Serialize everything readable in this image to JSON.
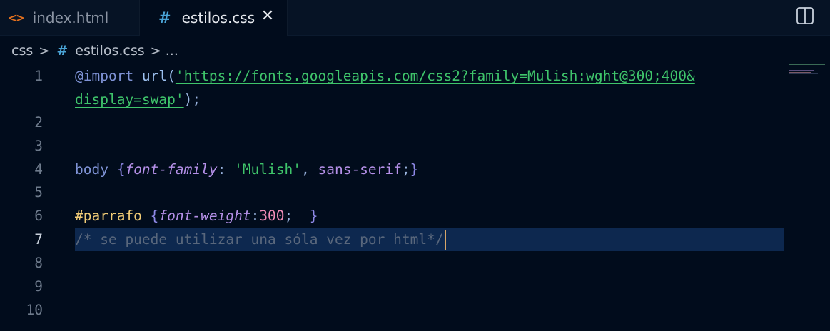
{
  "tabs": [
    {
      "icon": "<>",
      "label": "index.html",
      "active": false
    },
    {
      "icon": "#",
      "label": "estilos.css",
      "active": true,
      "close": "✕"
    }
  ],
  "breadcrumb": {
    "folder": "css",
    "file_icon": "#",
    "file": "estilos.css",
    "sep": ">",
    "more": "..."
  },
  "gutter": [
    "1",
    "2",
    "3",
    "4",
    "5",
    "6",
    "7",
    "8",
    "9",
    "10"
  ],
  "code": {
    "l1_at": "@import",
    "l1_fn": " url(",
    "l1_url": "'https://fonts.googleapis.com/css2?family=Mulish:wght@300;400&",
    "l1b_url": "display=swap'",
    "l1b_end": ");",
    "l4_sel": "body ",
    "l4_open": "{",
    "l4_prop": "font-family",
    "l4_colon": ": ",
    "l4_str": "'Mulish'",
    "l4_comma": ", ",
    "l4_val": "sans-serif",
    "l4_semi": ";",
    "l4_close": "}",
    "l6_sel": "#parrafo ",
    "l6_open": "{",
    "l6_prop": "font-weight",
    "l6_colon": ":",
    "l6_num": "300",
    "l6_semi": ";  ",
    "l6_close": "}",
    "l7_comment": "/* se puede utilizar una sóla vez por html*/"
  },
  "colors": {
    "background": "#010c1c",
    "tab_bar": "#061325",
    "current_line": "#0d284f",
    "string": "#3fc56b",
    "number": "#f28db8",
    "id_selector": "#f2cd77"
  },
  "active_line": 7
}
